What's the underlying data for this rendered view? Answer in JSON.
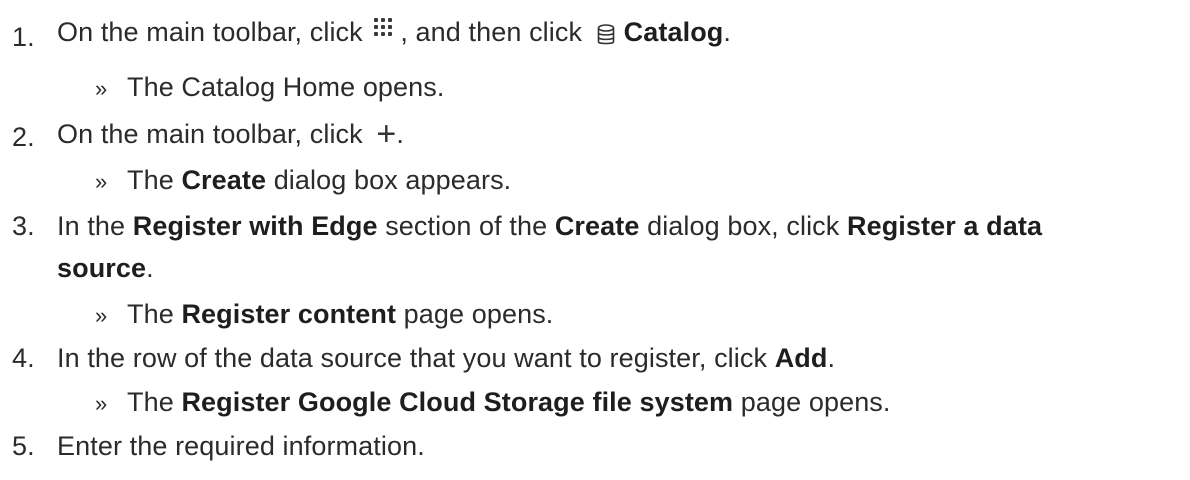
{
  "steps": [
    {
      "number": "1.",
      "parts": [
        "On the main toolbar, click ",
        ", and then click ",
        "Catalog",
        "."
      ],
      "result": null,
      "icons": [
        "grid-dots-icon",
        "database-icon"
      ]
    },
    {
      "result_chevron": "»",
      "result_text": "The Catalog Home opens."
    },
    {
      "number": "2.",
      "parts": [
        "On the main toolbar, click ",
        "."
      ],
      "icon_plus": "+"
    },
    {
      "result_chevron": "»",
      "parts": [
        "The ",
        "Create",
        " dialog box appears."
      ]
    },
    {
      "number": "3.",
      "parts": [
        "In the ",
        "Register with Edge",
        " section of the ",
        "Create",
        " dialog box, click ",
        "Register a data",
        "source",
        "."
      ]
    },
    {
      "result_chevron": "»",
      "parts": [
        "The ",
        "Register content",
        " page opens."
      ]
    },
    {
      "number": "4.",
      "parts": [
        "In the row of the data source that you want to register, click ",
        "Add",
        "."
      ]
    },
    {
      "result_chevron": "»",
      "parts": [
        "The ",
        "Register Google Cloud Storage file system",
        " page opens."
      ]
    },
    {
      "number": "5.",
      "parts": [
        "Enter the required information."
      ]
    }
  ],
  "colors": {
    "text": "#2b2b2b",
    "bold": "#1e1e1e",
    "background": "#ffffff"
  }
}
